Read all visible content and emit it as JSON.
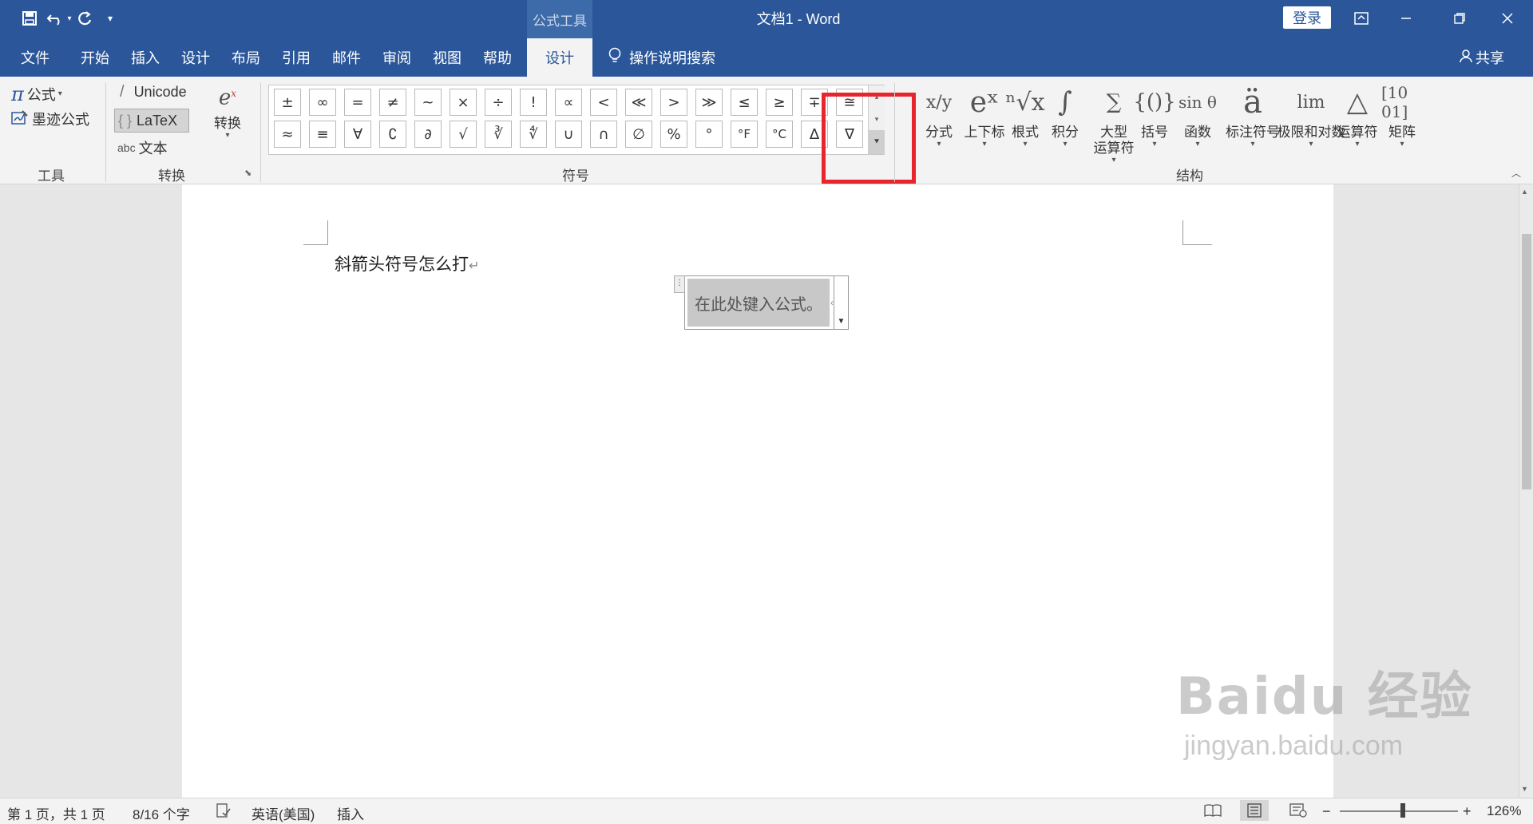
{
  "app": {
    "title": "文档1  -  Word",
    "context_tab": "公式工具",
    "login": "登录",
    "share": "共享",
    "tell_me": "操作说明搜索",
    "qat": {
      "save": "save-icon",
      "undo": "undo-icon",
      "redo": "redo-icon",
      "customize": "customize-icon"
    },
    "window_buttons": {
      "ribbon_display": "ribbon-display-icon",
      "minimize": "minimize-icon",
      "restore": "restore-icon",
      "close": "close-icon"
    }
  },
  "tabs": [
    "文件",
    "开始",
    "插入",
    "设计",
    "布局",
    "引用",
    "邮件",
    "审阅",
    "视图",
    "帮助",
    "设计"
  ],
  "active_tab_index": 10,
  "ribbon": {
    "tools": {
      "equation": "公式",
      "ink_equation": "墨迹公式",
      "group_label": "工具"
    },
    "conversion": {
      "unicode": "Unicode",
      "latex": "LaTeX",
      "text": "文本",
      "text_prefix": "abc",
      "convert": "转换",
      "group_label": "转换"
    },
    "symbols": {
      "group_label": "符号",
      "row1": [
        "±",
        "∞",
        "=",
        "≠",
        "~",
        "×",
        "÷",
        "!",
        "∝",
        "<",
        "≪",
        ">",
        "≫",
        "≤",
        "≥",
        "∓",
        "≅"
      ],
      "row2": [
        "≈",
        "≡",
        "∀",
        "∁",
        "∂",
        "√",
        "∛",
        "∜",
        "∪",
        "∩",
        "∅",
        "%",
        "°",
        "°F",
        "°C",
        "∆",
        "∇"
      ]
    },
    "structures": {
      "group_label": "结构",
      "items": [
        {
          "label": "分式",
          "icon": "x/y"
        },
        {
          "label": "上下标",
          "icon": "eˣ"
        },
        {
          "label": "根式",
          "icon": "ⁿ√x"
        },
        {
          "label": "积分",
          "icon": "∫"
        },
        {
          "label": "大型\n运算符",
          "icon": "∑"
        },
        {
          "label": "括号",
          "icon": "{()}"
        },
        {
          "label": "函数",
          "icon": "sin θ"
        },
        {
          "label": "标注符号",
          "icon": "ä"
        },
        {
          "label": "极限和对数",
          "icon": "lim"
        },
        {
          "label": "运算符",
          "icon": "△"
        },
        {
          "label": "矩阵",
          "icon": "[10 01]"
        }
      ]
    }
  },
  "document": {
    "line1": "斜箭头符号怎么打",
    "paragraph_mark": "↵",
    "equation_placeholder": "在此处键入公式。"
  },
  "status": {
    "page": "第 1 页，共 1 页",
    "words": "8/16 个字",
    "language": "英语(美国)",
    "mode": "插入",
    "zoom": "126%",
    "zoom_minus": "−",
    "zoom_plus": "+"
  },
  "watermark": {
    "brand": "Baidu 经验",
    "url": "jingyan.baidu.com"
  },
  "highlight_color": "#e8242c"
}
